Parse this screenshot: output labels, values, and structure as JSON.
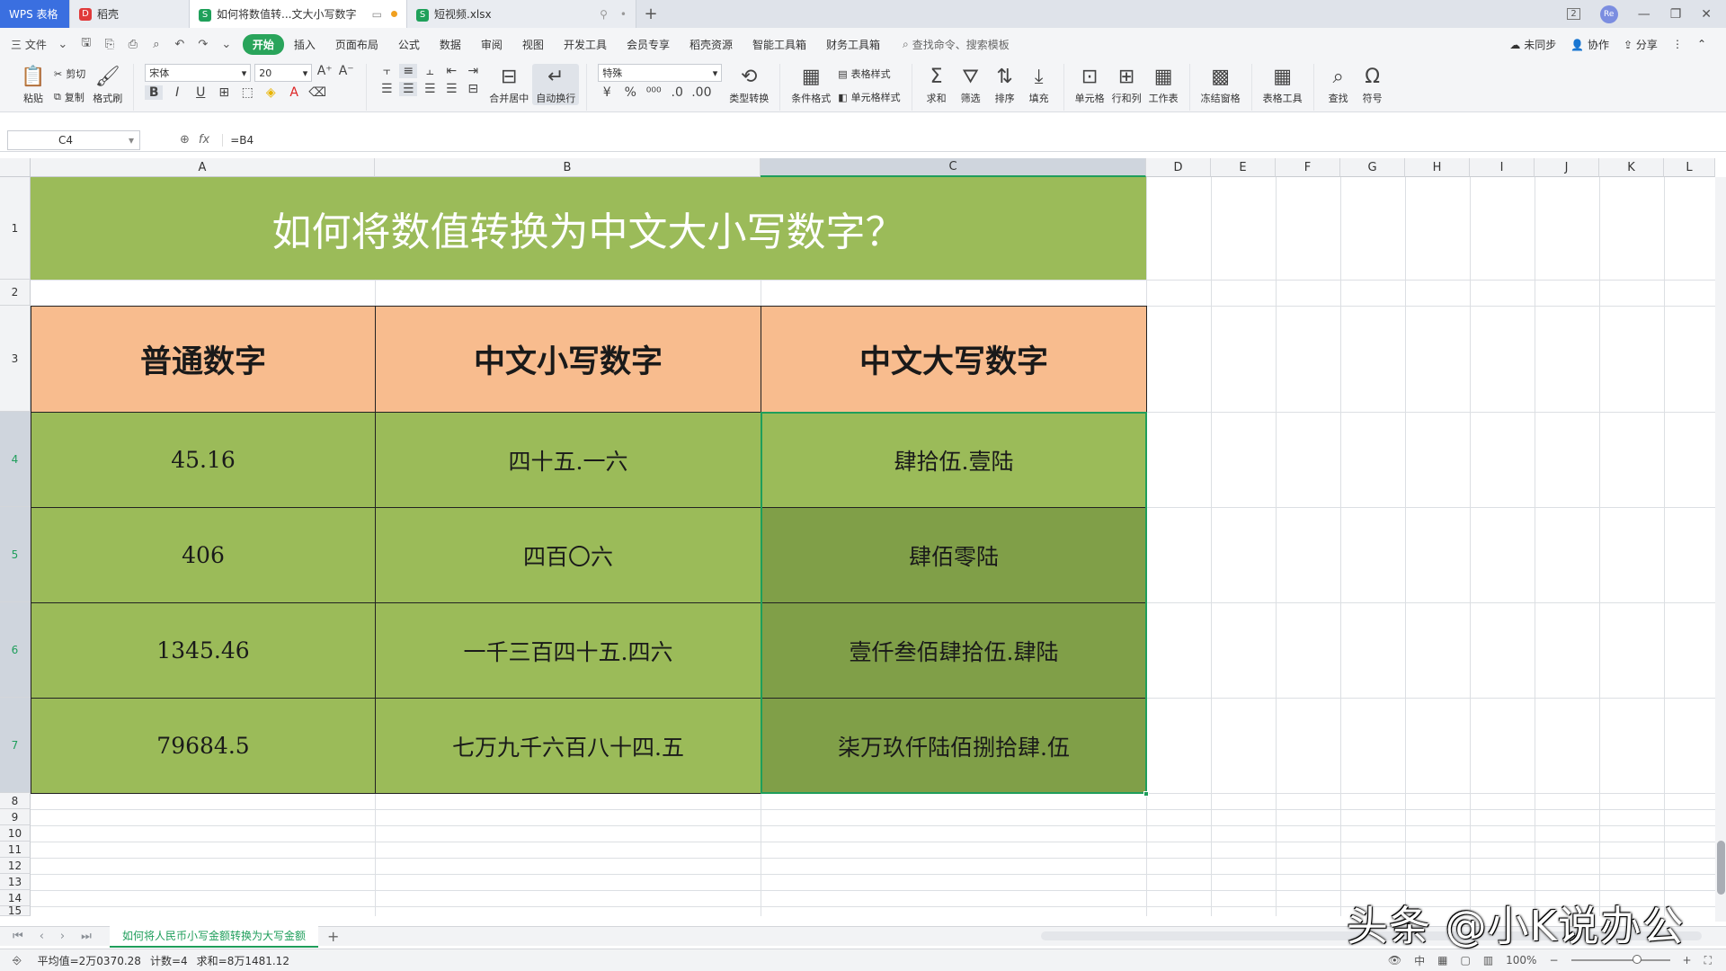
{
  "titlebar": {
    "app_tab": "WPS 表格",
    "tabs": [
      {
        "label": "稻壳"
      },
      {
        "label": "如何将数值转...文大小写数字"
      },
      {
        "label": "短视频.xlsx"
      }
    ],
    "new_tab": "+",
    "badge": "2"
  },
  "menubar": {
    "file": "三 文件",
    "items": [
      "开始",
      "插入",
      "页面布局",
      "公式",
      "数据",
      "审阅",
      "视图",
      "开发工具",
      "会员专享",
      "稻壳资源",
      "智能工具箱",
      "财务工具箱"
    ],
    "search_placeholder": "查找命令、搜索模板",
    "right": [
      "未同步",
      "协作",
      "分享"
    ]
  },
  "ribbon": {
    "paste": "粘贴",
    "cut": "剪切",
    "copy": "复制",
    "format_painter": "格式刷",
    "font_name": "宋体",
    "font_size": "20",
    "merge_center": "合并居中",
    "wrap_text": "自动换行",
    "number_format": "特殊",
    "convert_type": "类型转换",
    "conditional_format": "条件格式",
    "table_style": "表格样式",
    "cell_style": "单元格样式",
    "sum": "求和",
    "filter": "筛选",
    "sort": "排序",
    "fill": "填充",
    "cell": "单元格",
    "row_col": "行和列",
    "worksheet": "工作表",
    "freeze": "冻结窗格",
    "table_tools": "表格工具",
    "find": "查找",
    "symbol": "符号"
  },
  "formula_bar": {
    "name_box": "C4",
    "formula": "=B4"
  },
  "columns": [
    "A",
    "B",
    "C",
    "D",
    "E",
    "F",
    "G",
    "H",
    "I",
    "J",
    "K",
    "L"
  ],
  "rows": [
    "1",
    "2",
    "3",
    "4",
    "5",
    "6",
    "7",
    "8",
    "9",
    "10",
    "11",
    "12",
    "13",
    "14",
    "15"
  ],
  "sheet": {
    "title": "如何将数值转换为中文大小写数字？",
    "headers": [
      "普通数字",
      "中文小写数字",
      "中文大写数字"
    ],
    "data": [
      [
        "45.16",
        "四十五.一六",
        "肆拾伍.壹陆"
      ],
      [
        "406",
        "四百〇六",
        "肆佰零陆"
      ],
      [
        "1345.46",
        "一千三百四十五.四六",
        "壹仟叁佰肆拾伍.肆陆"
      ],
      [
        "79684.5",
        "七万九千六百八十四.五",
        "柒万玖仟陆佰捌拾肆.伍"
      ]
    ],
    "colors": {
      "title_bg": "#9bbb59",
      "header_bg": "#f8bc8e",
      "data_bg": "#9bbb59",
      "data_dark_bg": "#809f48",
      "selection": "#1f9e5b"
    }
  },
  "sheet_tabs": [
    "如何将人民币小写金额转换为大写金额"
  ],
  "status": {
    "average": "平均值=2万0370.28",
    "count": "计数=4",
    "sum": "求和=8万1481.12",
    "zoom": "100%"
  },
  "watermark": "头条 @小K说办公"
}
